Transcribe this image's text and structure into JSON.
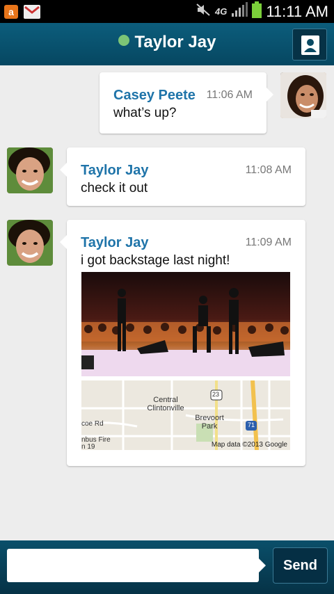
{
  "status_bar": {
    "time": "11:11 AM",
    "network": "4G",
    "icons": [
      "app-notification-icon",
      "gmail-icon",
      "mute-icon",
      "signal-icon",
      "battery-icon"
    ]
  },
  "header": {
    "contact_name": "Taylor Jay",
    "online_color": "#7cc576",
    "contact_button_icon": "contact-card-icon"
  },
  "messages": [
    {
      "sender": "Casey Peete",
      "time": "11:06 AM",
      "text": "what’s up?"
    },
    {
      "sender": "Taylor Jay",
      "time": "11:08 AM",
      "text": "check it out"
    },
    {
      "sender": "Taylor Jay",
      "time": "11:09 AM",
      "text": "i got backstage last night!"
    }
  ],
  "map": {
    "labels": [
      "Central Clintonville",
      "Brevoort Park",
      "coe Rd",
      "nbus Fire",
      "n 19"
    ],
    "route_shields": [
      "23",
      "71"
    ],
    "credit": "Map data ©2013 Google"
  },
  "composer": {
    "placeholder": "",
    "send_label": "Send"
  },
  "colors": {
    "header": "#0c5d7c",
    "sender_name": "#1f74a9",
    "background": "#ededed"
  }
}
